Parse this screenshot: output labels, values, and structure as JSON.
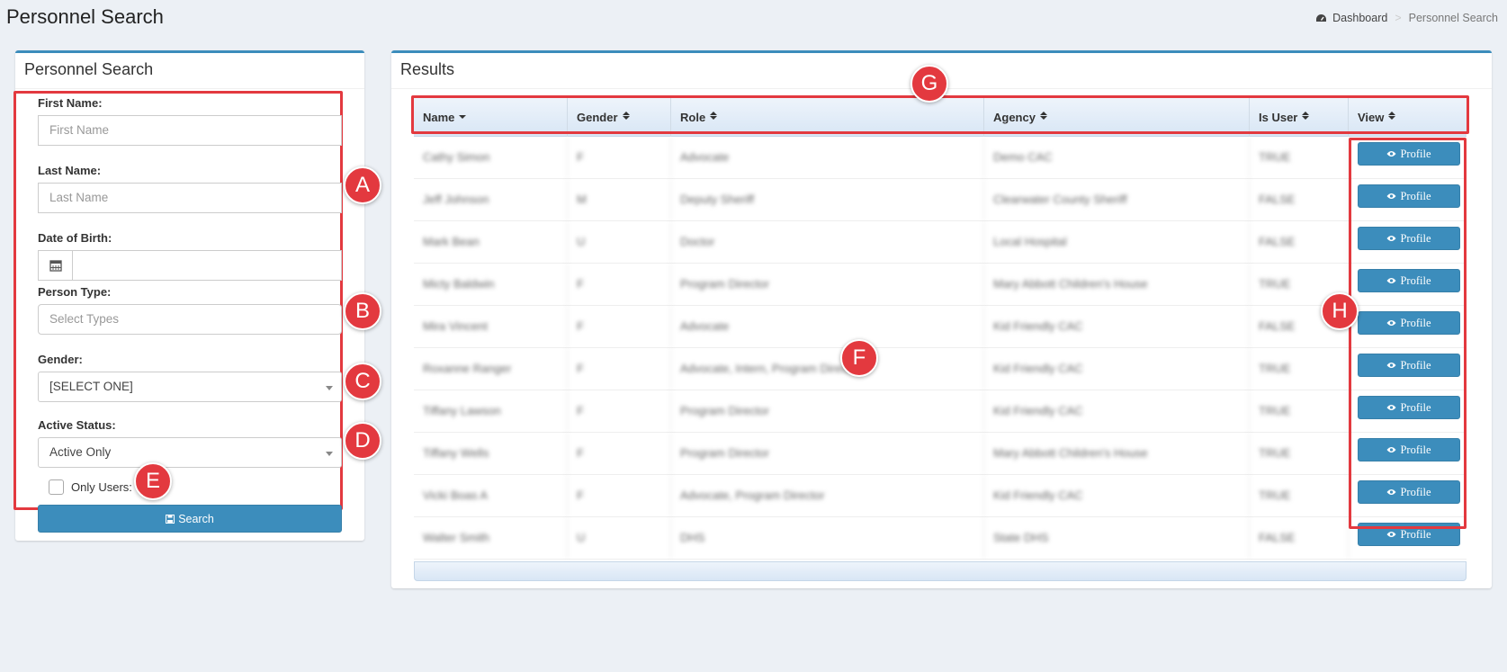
{
  "header": {
    "title": "Personnel Search",
    "breadcrumb": {
      "home": "Dashboard",
      "current": "Personnel Search"
    }
  },
  "search_panel": {
    "title": "Personnel Search",
    "first_name": {
      "label": "First Name:",
      "placeholder": "First Name"
    },
    "last_name": {
      "label": "Last Name:",
      "placeholder": "Last Name"
    },
    "dob": {
      "label": "Date of Birth:"
    },
    "person_type": {
      "label": "Person Type:",
      "placeholder": "Select Types"
    },
    "gender": {
      "label": "Gender:",
      "value": "[SELECT ONE]"
    },
    "active_status": {
      "label": "Active Status:",
      "value": "Active Only"
    },
    "only_users": {
      "label": "Only Users:"
    },
    "search_button": "Search"
  },
  "results": {
    "title": "Results",
    "columns": [
      "Name",
      "Gender",
      "Role",
      "Agency",
      "Is User",
      "View"
    ],
    "button_label": "Profile",
    "rows": [
      {
        "name": "Cathy Simon",
        "gender": "F",
        "role": "Advocate",
        "agency": "Demo CAC",
        "is_user": "TRUE"
      },
      {
        "name": "Jeff Johnson",
        "gender": "M",
        "role": "Deputy Sheriff",
        "agency": "Clearwater County Sheriff",
        "is_user": "FALSE"
      },
      {
        "name": "Mark Bean",
        "gender": "U",
        "role": "Doctor",
        "agency": "Local Hospital",
        "is_user": "FALSE"
      },
      {
        "name": "Micty Baldwin",
        "gender": "F",
        "role": "Program Director",
        "agency": "Mary Abbott Children's House",
        "is_user": "TRUE"
      },
      {
        "name": "Mira Vincent",
        "gender": "F",
        "role": "Advocate",
        "agency": "Kid Friendly CAC",
        "is_user": "FALSE"
      },
      {
        "name": "Roxanne Ranger",
        "gender": "F",
        "role": "Advocate, Intern, Program Director",
        "agency": "Kid Friendly CAC",
        "is_user": "TRUE"
      },
      {
        "name": "Tiffany Lawson",
        "gender": "F",
        "role": "Program Director",
        "agency": "Kid Friendly CAC",
        "is_user": "TRUE"
      },
      {
        "name": "Tiffany Wells",
        "gender": "F",
        "role": "Program Director",
        "agency": "Mary Abbott Children's House",
        "is_user": "TRUE"
      },
      {
        "name": "Vicki Boas A",
        "gender": "F",
        "role": "Advocate, Program Director",
        "agency": "Kid Friendly CAC",
        "is_user": "TRUE"
      },
      {
        "name": "Walter Smith",
        "gender": "U",
        "role": "DHS",
        "agency": "State DHS",
        "is_user": "FALSE"
      }
    ]
  },
  "markers": [
    "A",
    "B",
    "C",
    "D",
    "E",
    "F",
    "G",
    "H"
  ],
  "colors": {
    "accent": "#3c8dbc",
    "annotation": "#e3393f",
    "background": "#ecf0f5"
  }
}
